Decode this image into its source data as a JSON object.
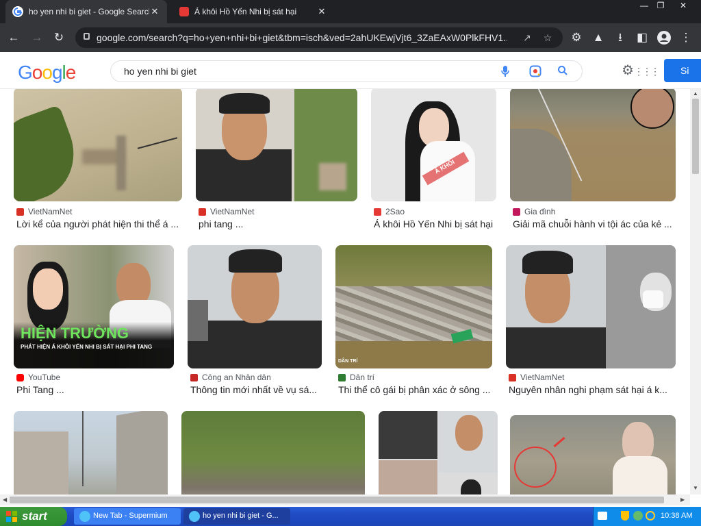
{
  "tabs": [
    {
      "title": "ho yen nhi bi giet - Google Search",
      "close": "✕",
      "active": true
    },
    {
      "title": "Á khôi Hồ Yến Nhi bị sát hại",
      "close": "✕",
      "active": false
    }
  ],
  "window_controls": {
    "minimize": "—",
    "restore": "❐",
    "close": "✕"
  },
  "address": {
    "url": "google.com/search?q=ho+yen+nhi+bi+giet&tbm=isch&ved=2ahUKEwjVjt6_3ZaEAxW0PlkFHV1..."
  },
  "search": {
    "query": "ho yen nhi bi giet",
    "sign_in": "Si"
  },
  "logo": {
    "letters": [
      "G",
      "o",
      "o",
      "g",
      "l",
      "e"
    ],
    "colors": [
      "#4285f4",
      "#ea4335",
      "#fbbc05",
      "#4285f4",
      "#34a853",
      "#ea4335"
    ]
  },
  "results": [
    {
      "source": "VietNamNet",
      "caption": "Lời kể của người phát hiện thi thể á ...",
      "icon": "vietnamnet-icon",
      "icon_color": "#d93025"
    },
    {
      "source": "VietNamNet",
      "caption": "phi tang ...",
      "icon": "vietnamnet-icon",
      "icon_color": "#d93025"
    },
    {
      "source": "2Sao",
      "caption": "Á khôi Hồ Yến Nhi bị sát hại",
      "icon": "2sao-icon",
      "icon_color": "#e53935"
    },
    {
      "source": "Gia đình",
      "caption": "Giải mã chuỗi hành vi tội ác của kẻ ...",
      "icon": "giadinh-icon",
      "icon_color": "#c2185b"
    },
    {
      "source": "YouTube",
      "caption": "Phi Tang ...",
      "icon": "youtube-icon",
      "icon_color": "#ff0000"
    },
    {
      "source": "Công an Nhân dân",
      "caption": "Thông tin mới nhất về vụ sá...",
      "icon": "cand-icon",
      "icon_color": "#c62828"
    },
    {
      "source": "Dân trí",
      "caption": "Thi thể cô gái bị phân xác ở sông ...",
      "icon": "dantri-icon",
      "icon_color": "#2e7d32"
    },
    {
      "source": "VietNamNet",
      "caption": "Nguyên nhân nghi phạm sát hại á k...",
      "icon": "vietnamnet-icon",
      "icon_color": "#d93025"
    },
    {
      "source": "",
      "caption": "",
      "icon": "",
      "icon_color": ""
    },
    {
      "source": "",
      "caption": "",
      "icon": "",
      "icon_color": ""
    },
    {
      "source": "",
      "caption": "",
      "icon": "",
      "icon_color": ""
    },
    {
      "source": "",
      "caption": "",
      "icon": "",
      "icon_color": ""
    }
  ],
  "thumbnail_text": {
    "overlay_title": "HIỆN TRƯỜNG",
    "overlay_sub": "PHÁT HIỆN Á KHÔI YẾN NHI BỊ SÁT HẠI PHI TANG",
    "sash": "Á KHÔI",
    "watermark": "DÂN TRÍ"
  },
  "taskbar": {
    "start": "start",
    "items": [
      {
        "label": "New Tab - Supermium",
        "active": false
      },
      {
        "label": "ho yen nhi bi giet - G...",
        "active": true
      }
    ],
    "clock": "10:38 AM"
  }
}
